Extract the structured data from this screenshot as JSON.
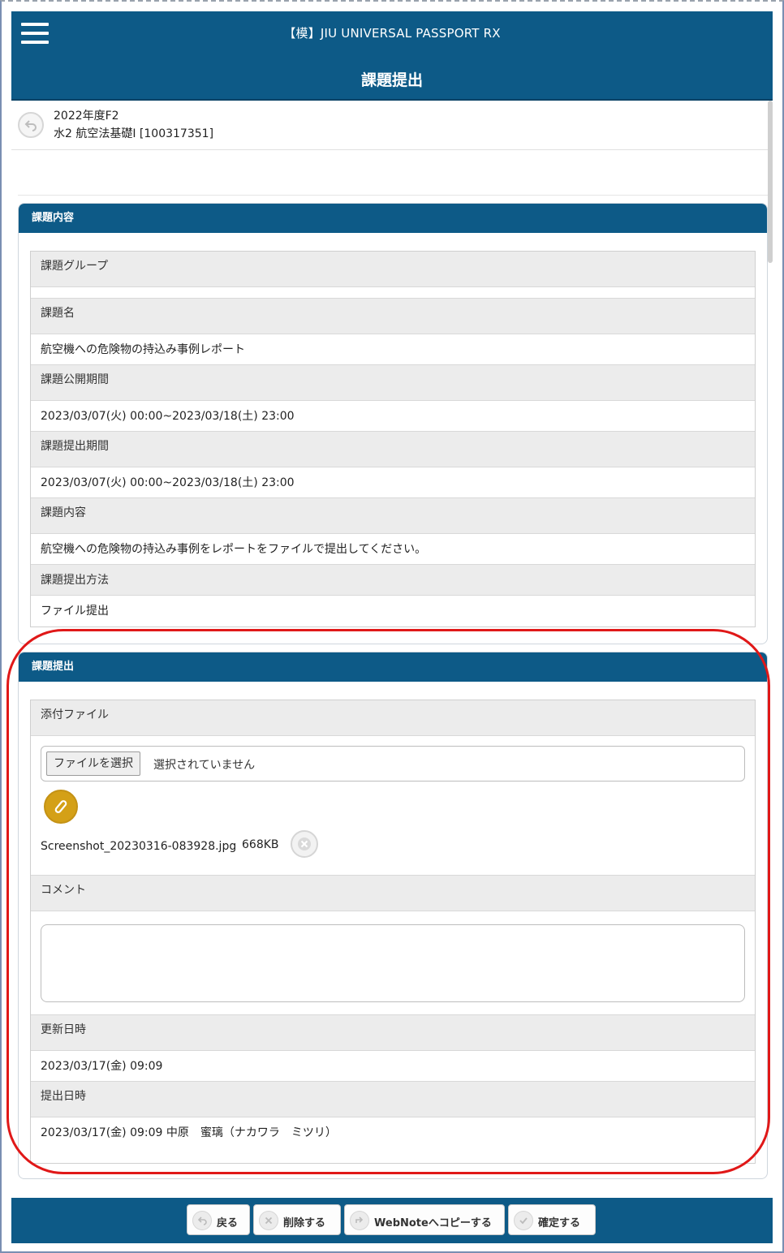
{
  "header": {
    "app_title": "【模】JIU UNIVERSAL PASSPORT RX",
    "page_title": "課題提出"
  },
  "course": {
    "term": "2022年度F2",
    "name": "水2  航空法基礎I  [100317351]"
  },
  "assignment_panel": {
    "title": "課題内容",
    "rows": [
      {
        "label": "課題グループ",
        "value": ""
      },
      {
        "label": "課題名",
        "value": "航空機への危険物の持込み事例レポート"
      },
      {
        "label": "課題公開期間",
        "value": "2023/03/07(火) 00:00~2023/03/18(土) 23:00"
      },
      {
        "label": "課題提出期間",
        "value": "2023/03/07(火) 00:00~2023/03/18(土) 23:00"
      },
      {
        "label": "課題内容",
        "value": "航空機への危険物の持込み事例をレポートをファイルで提出してください。"
      },
      {
        "label": "課題提出方法",
        "value": "ファイル提出"
      }
    ]
  },
  "submission_panel": {
    "title": "課題提出",
    "attachment_label": "添付ファイル",
    "file_button": "ファイルを選択",
    "file_status": "選択されていません",
    "attached_file": {
      "name": "Screenshot_20230316-083928.jpg",
      "size": "668KB"
    },
    "comment_label": "コメント",
    "comment_value": "",
    "updated_label": "更新日時",
    "updated_value": "2023/03/17(金) 09:09",
    "submitted_label": "提出日時",
    "submitted_value": "2023/03/17(金) 09:09 中原　蜜璃（ナカワラ　ミツリ）"
  },
  "footer": {
    "back_label": "戻る",
    "delete_label": "削除する",
    "webnote_label": "WebNoteへコピーする",
    "confirm_label": "確定する"
  },
  "icons": {
    "menu": "hamburger-icon",
    "back": "back-arrow-icon",
    "attach": "paperclip-icon",
    "remove": "close-circle-icon",
    "delete": "delete-icon",
    "copy": "copy-icon",
    "confirm": "check-icon"
  },
  "colors": {
    "header_blue": "#0d5a87",
    "label_gray": "#ececec",
    "attach_gold": "#d4a017",
    "highlight_red": "#e01818"
  }
}
